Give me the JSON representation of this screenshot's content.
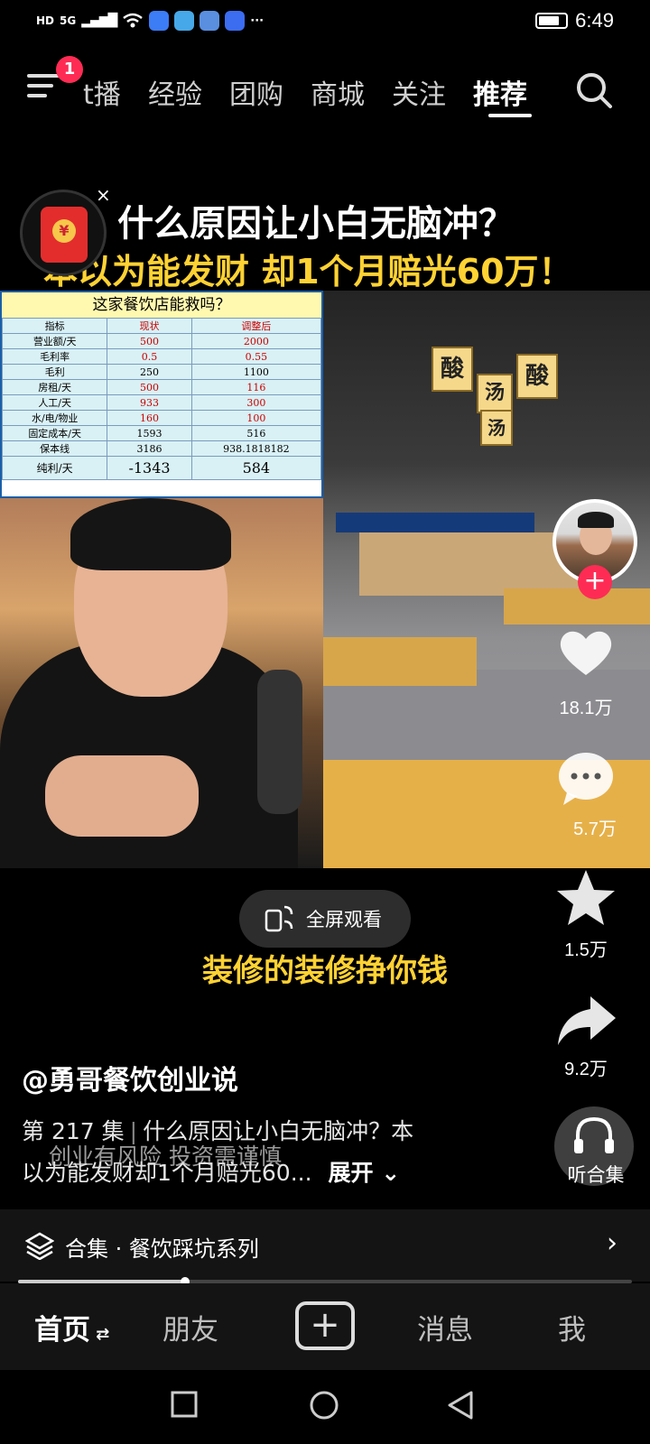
{
  "status_bar": {
    "hd": "HD",
    "net": "5G",
    "time": "6:49",
    "more": "···"
  },
  "top_nav": {
    "notification_count": "1",
    "tabs": [
      {
        "label": "t播",
        "active": false
      },
      {
        "label": "经验",
        "active": false
      },
      {
        "label": "团购",
        "active": false
      },
      {
        "label": "商城",
        "active": false
      },
      {
        "label": "关注",
        "active": false
      },
      {
        "label": "推荐",
        "active": true
      }
    ]
  },
  "video": {
    "caption_line1": "什么原因让小白无脑冲？",
    "caption_line2": "本以为能发财 却1个月赔光60万！",
    "redpack_close": "×",
    "redpack_coin": "¥",
    "subtitle": "装修的装修挣你钱",
    "fullscreen_label": "全屏观看",
    "lanterns": [
      "酸",
      "汤",
      "酸",
      "汤"
    ],
    "table": {
      "title": "这家餐饮店能救吗？",
      "headers": [
        "指标",
        "现状",
        "调整后"
      ],
      "rows": [
        [
          "营业额/天",
          "500",
          "2000"
        ],
        [
          "毛利率",
          "0.5",
          "0.55"
        ],
        [
          "毛利",
          "250",
          "1100"
        ],
        [
          "房租/天",
          "500",
          "116"
        ],
        [
          "人工/天",
          "933",
          "300"
        ],
        [
          "水/电/物业",
          "160",
          "100"
        ],
        [
          "固定成本/天",
          "1593",
          "516"
        ],
        [
          "保本线",
          "3186",
          "938.1818182"
        ],
        [
          "纯利/天",
          "-1343",
          "584"
        ]
      ]
    }
  },
  "right_rail": {
    "follow": "+",
    "likes": "18.1万",
    "comments": "5.7万",
    "favorites": "1.5万",
    "shares": "9.2万",
    "listen_label": "听合集"
  },
  "post": {
    "author": "@勇哥餐饮创业说",
    "episode": "第 217 集",
    "desc_line1": "什么原因让小白无脑冲？本",
    "desc_line2": "以为能发财却1个月赔光60...",
    "expand": "展开",
    "overlay_text": "创业有风险 投资需谨慎"
  },
  "collection": {
    "label": "合集 · 餐饮踩坑系列",
    "progress": 0.27
  },
  "bottom_nav": {
    "home": "首页",
    "friends": "朋友",
    "plus": "+",
    "messages": "消息",
    "me": "我"
  },
  "colors": {
    "accent_red": "#fe2c55",
    "caption_yellow": "#ffd233"
  }
}
